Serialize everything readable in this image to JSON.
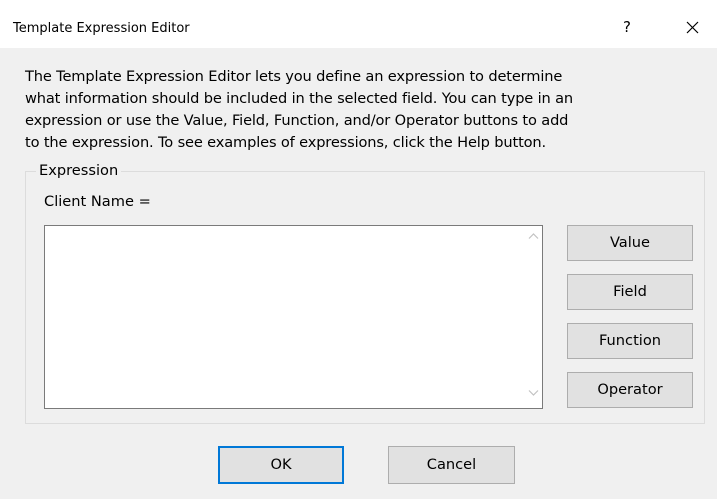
{
  "window": {
    "title": "Template Expression Editor",
    "help_label": "?"
  },
  "description": {
    "lines": [
      "The Template Expression Editor lets you define an expression to determine",
      "what information should be included in the selected field.  You can type in an",
      "expression or use the Value, Field, Function, and/or Operator buttons to add",
      "to the expression.  To see examples of expressions, click the Help button."
    ]
  },
  "expression": {
    "group_label": "Expression",
    "prefix": "Client Name =",
    "value": ""
  },
  "buttons": {
    "value": "Value",
    "field": "Field",
    "function": "Function",
    "operator": "Operator",
    "ok": "OK",
    "cancel": "Cancel"
  },
  "colors": {
    "dialog_bg": "#f0f0f0",
    "titlebar_bg": "#ffffff",
    "default_button_border": "#0078d7"
  },
  "icons": {
    "close": "close-icon",
    "scroll_up": "chevron-up-icon",
    "scroll_down": "chevron-down-icon"
  }
}
